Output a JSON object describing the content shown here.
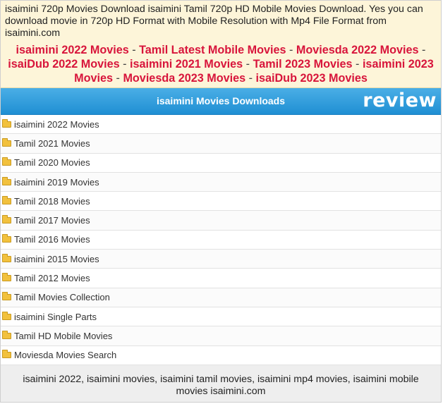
{
  "intro": {
    "text": "isaimini 720p Movies Download isaimini Tamil 720p HD Mobile Movies Download. Yes you can download movie in 720p HD Format with Mobile Resolution with Mp4 File Format from isaimini.com"
  },
  "links": [
    "isaimini 2022 Movies",
    "Tamil Latest Mobile Movies",
    "Moviesda 2022 Movies",
    "isaiDub 2022 Movies",
    "isaimini 2021 Movies",
    "Tamil 2023 Movies",
    "isaimini 2023 Movies",
    "Moviesda 2023 Movies",
    "isaiDub 2023 Movies"
  ],
  "link_separator": " - ",
  "header": {
    "title": "isaimini Movies Downloads",
    "watermark": "review"
  },
  "list_items": [
    "isaimini 2022 Movies",
    "Tamil 2021 Movies",
    "Tamil 2020 Movies",
    "isaimini 2019 Movies",
    "Tamil 2018 Movies",
    "Tamil 2017 Movies",
    "Tamil 2016 Movies",
    "isaimini 2015 Movies",
    "Tamil 2012 Movies",
    "Tamil Movies Collection",
    "isaimini Single Parts",
    "Tamil HD Mobile Movies",
    "Moviesda Movies Search"
  ],
  "icons": {
    "list_item_icon": "folder-icon"
  },
  "colors": {
    "intro_bg": "#fdf5d9",
    "link_color": "#d8153b",
    "header_bg": "#2a98d8",
    "footer_bg": "#eeeeee"
  },
  "footer": {
    "text": "isaimini 2022, isaimini movies, isaimini tamil movies, isaimini mp4 movies, isaimini mobile movies isaimini.com"
  }
}
